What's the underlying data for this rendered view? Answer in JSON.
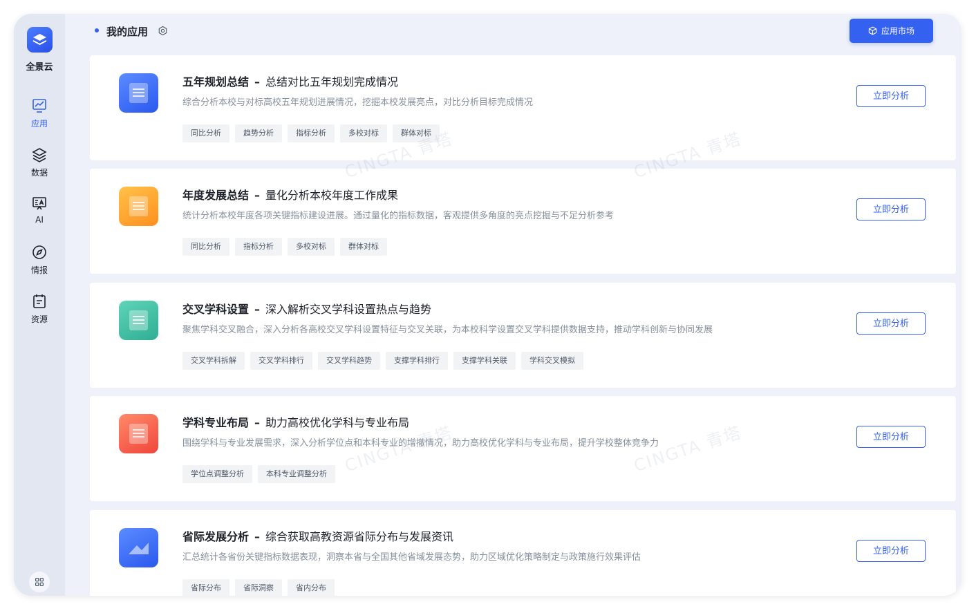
{
  "brand": {
    "name": "全景云"
  },
  "sidebar": {
    "items": [
      {
        "label": "应用",
        "icon": "chart-board-icon",
        "active": true
      },
      {
        "label": "数据",
        "icon": "layers-icon",
        "active": false
      },
      {
        "label": "AI",
        "icon": "ai-screen-icon",
        "active": false
      },
      {
        "label": "情报",
        "icon": "compass-icon",
        "active": false
      },
      {
        "label": "资源",
        "icon": "clipboard-icon",
        "active": false
      }
    ],
    "bottom_icon": "apps-grid-icon"
  },
  "header": {
    "title": "我的应用",
    "settings_icon": "gear-icon",
    "market_label": "应用市场",
    "market_icon": "cube-icon"
  },
  "colors": {
    "accent": "#3461f0",
    "text": "#1d2129",
    "muted": "#86909c"
  },
  "watermark": {
    "text": "CINGTA 青塔"
  },
  "cards": [
    {
      "title": "五年规划总结",
      "separator": "–",
      "subtitle": "总结对比五年规划完成情况",
      "desc": "综合分析本校与对标高校五年规划进展情况，挖掘本校发展亮点，对比分析目标完成情况",
      "tags": [
        "同比分析",
        "趋势分析",
        "指标分析",
        "多校对标",
        "群体对标"
      ],
      "action": "立即分析",
      "icon": "blue-report-icon"
    },
    {
      "title": "年度发展总结",
      "separator": "–",
      "subtitle": "量化分析本校年度工作成果",
      "desc": "统计分析本校年度各项关键指标建设进展。通过量化的指标数据，客观提供多角度的亮点挖掘与不足分析参考",
      "tags": [
        "同比分析",
        "指标分析",
        "多校对标",
        "群体对标"
      ],
      "action": "立即分析",
      "icon": "orange-report-icon"
    },
    {
      "title": "交叉学科设置",
      "separator": "–",
      "subtitle": "深入解析交叉学科设置热点与趋势",
      "desc": "聚焦学科交叉融合，深入分析各高校交叉学科设置特征与交叉关联，为本校科学设置交叉学科提供数据支持，推动学科创新与协同发展",
      "tags": [
        "交叉学科拆解",
        "交叉学科排行",
        "交叉学科趋势",
        "支撑学科排行",
        "支撑学科关联",
        "学科交叉模拟"
      ],
      "action": "立即分析",
      "icon": "green-edit-icon"
    },
    {
      "title": "学科专业布局",
      "separator": "–",
      "subtitle": "助力高校优化学科与专业布局",
      "desc": "围绕学科与专业发展需求，深入分析学位点和本科专业的增撤情况，助力高校优化学科与专业布局，提升学校整体竞争力",
      "tags": [
        "学位点调整分析",
        "本科专业调整分析"
      ],
      "action": "立即分析",
      "icon": "red-layers-icon"
    },
    {
      "title": "省际发展分析",
      "separator": "–",
      "subtitle": "综合获取高教资源省际分布与发展资讯",
      "desc": "汇总统计各省份关键指标数据表现，洞察本省与全国其他省域发展态势，助力区域优化策略制定与政策施行效果评估",
      "tags": [
        "省际分布",
        "省际洞察",
        "省内分布"
      ],
      "action": "立即分析",
      "icon": "blue-map-icon"
    }
  ]
}
